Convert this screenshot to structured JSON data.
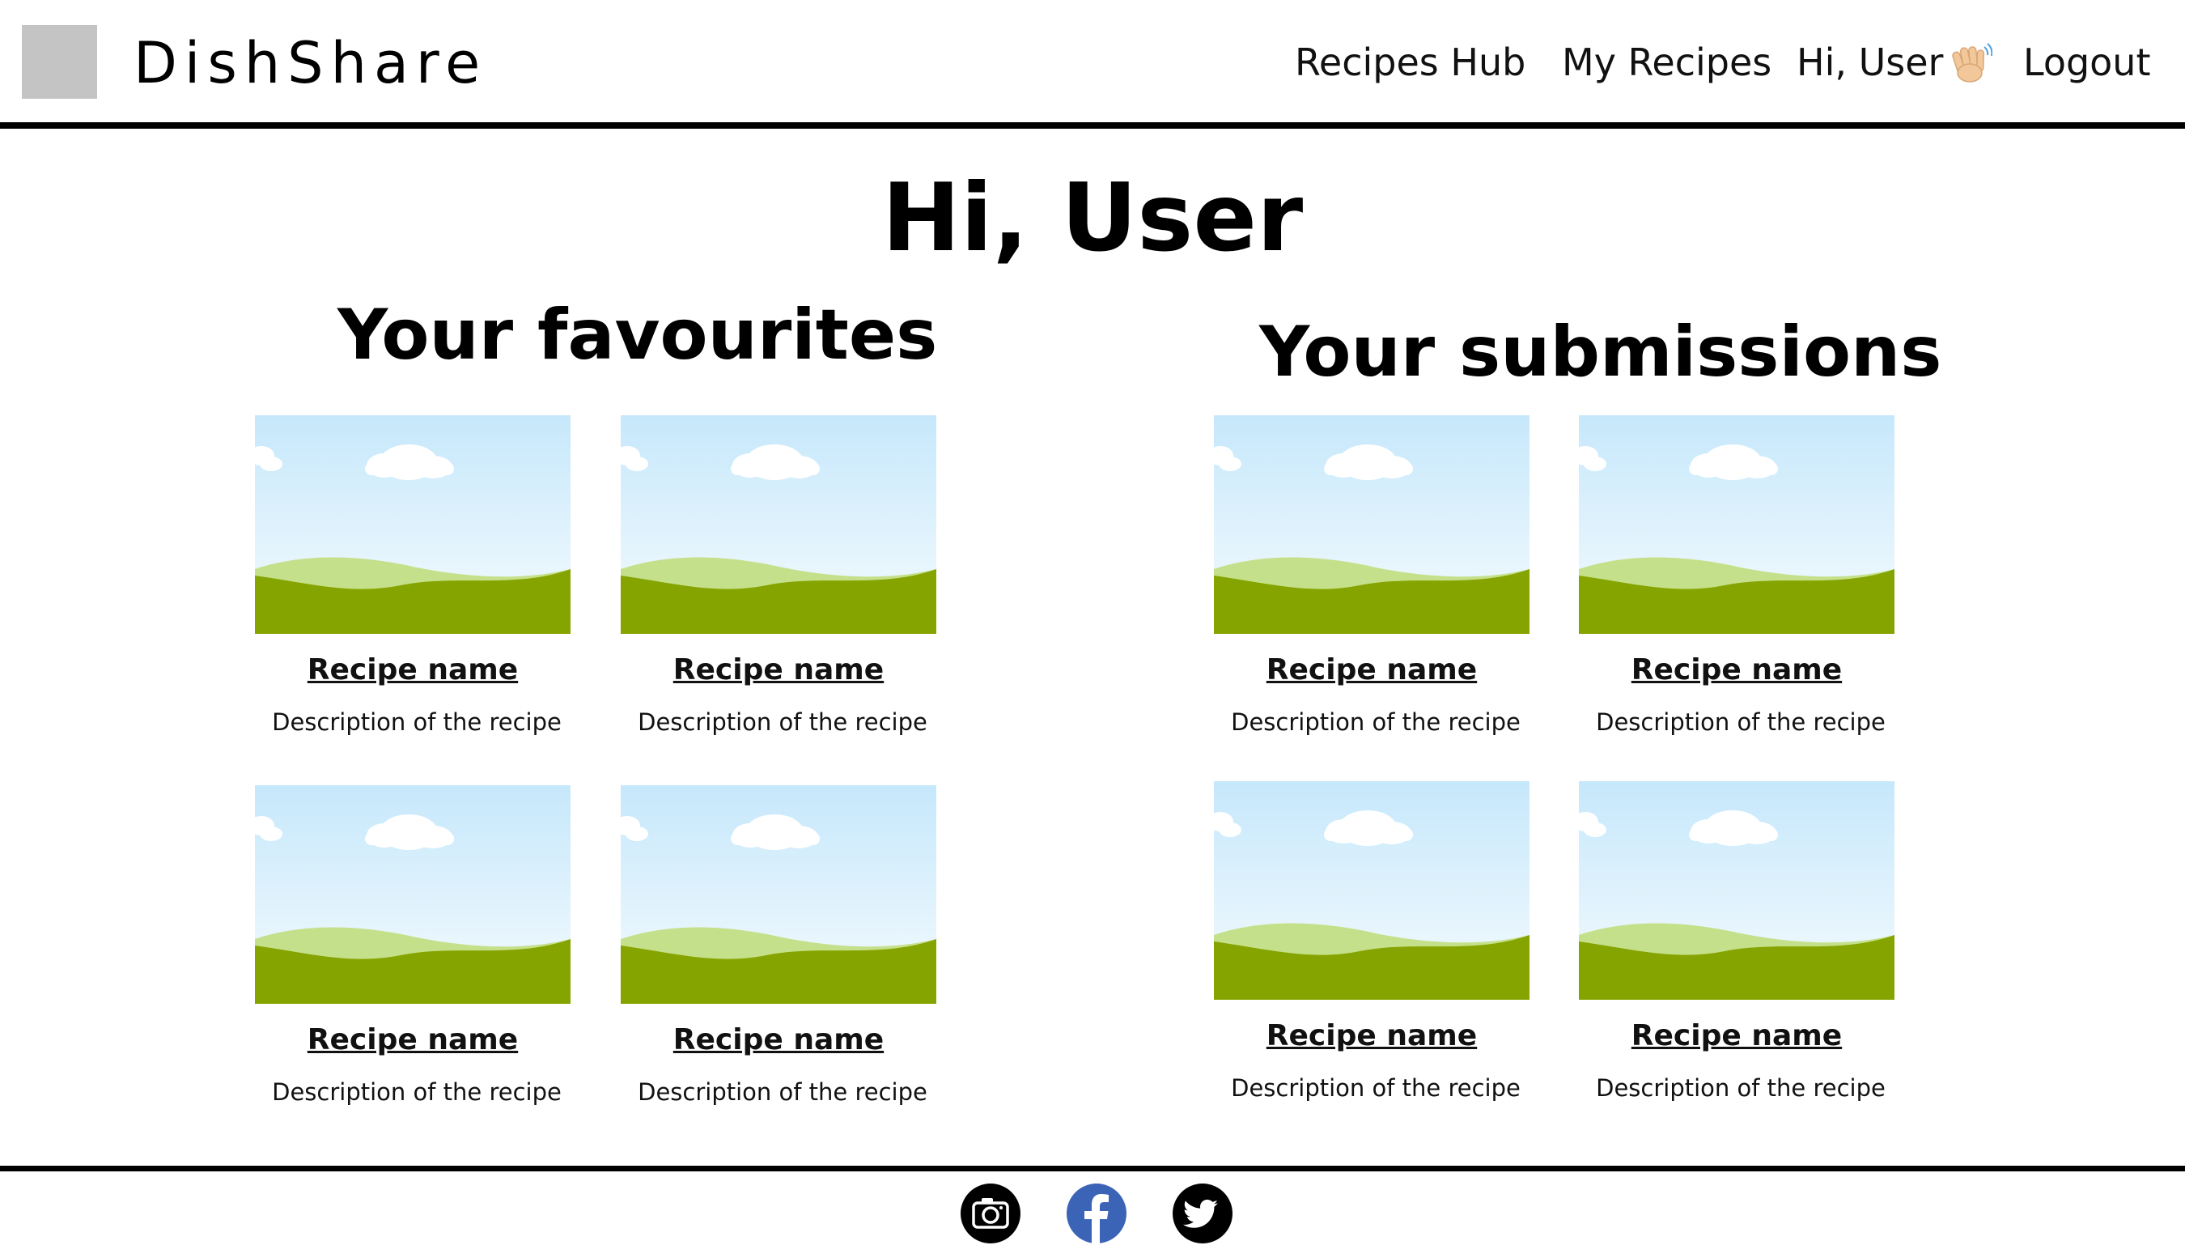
{
  "header": {
    "brand": "DishShare",
    "nav": {
      "recipes_hub": "Recipes Hub",
      "my_recipes": "My Recipes",
      "greeting": "Hi, User",
      "logout": "Logout"
    }
  },
  "main": {
    "title": "Hi, User",
    "favourites": {
      "heading": "Your favourites",
      "cards": [
        {
          "name": "Recipe name",
          "description": "Description of the recipe"
        },
        {
          "name": "Recipe name",
          "description": "Description of the recipe"
        },
        {
          "name": "Recipe name",
          "description": "Description of the recipe"
        },
        {
          "name": "Recipe name",
          "description": "Description of the recipe"
        }
      ]
    },
    "submissions": {
      "heading": "Your submissions",
      "cards": [
        {
          "name": "Recipe name",
          "description": "Description of the recipe"
        },
        {
          "name": "Recipe name",
          "description": "Description of the recipe"
        },
        {
          "name": "Recipe name",
          "description": "Description of the recipe"
        },
        {
          "name": "Recipe name",
          "description": "Description of the recipe"
        }
      ]
    }
  },
  "footer": {
    "social_icons": [
      "camera-icon",
      "facebook-icon",
      "twitter-icon"
    ]
  },
  "colors": {
    "sky_top": "#c6e8fb",
    "sky_bottom": "#f6fbfe",
    "hill_light": "#c5e08a",
    "hill_dark": "#86a400",
    "facebook_blue": "#3b64b7",
    "placeholder_logo": "#c4c4c4"
  }
}
